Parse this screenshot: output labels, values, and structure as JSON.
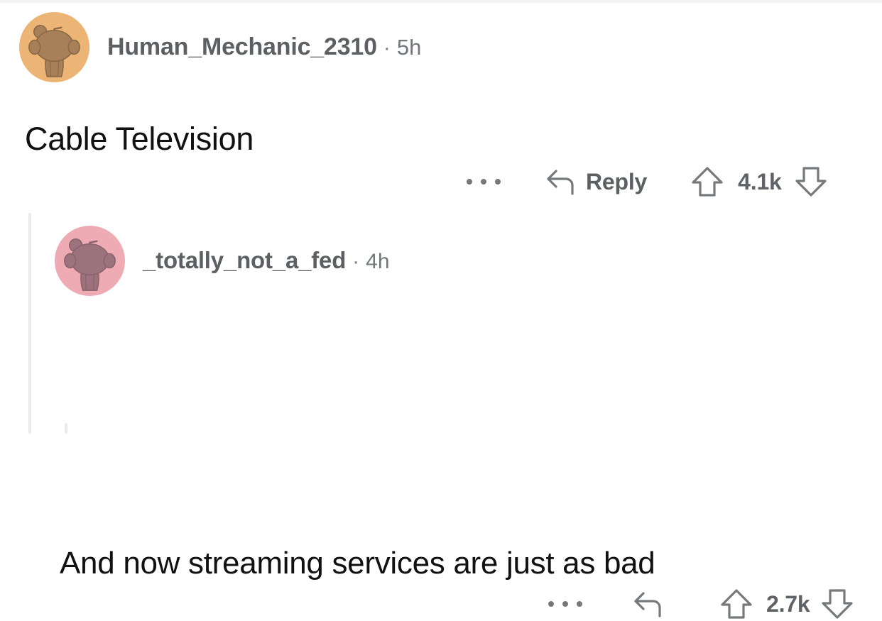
{
  "page": {
    "background_color": "#ffffff",
    "top_strip_color": "#f2f3f4",
    "thread_line_color": "#e8eaec"
  },
  "comments": [
    {
      "id": "root",
      "author": "Human_Mechanic_2310",
      "separator": "·",
      "timestamp": "5h",
      "body": "Cable Television",
      "avatar": {
        "icon": "reddit-snoo-avatar",
        "background_color": "#ecb575",
        "figure_color": "#a17b55",
        "outline_color": "#8a6845"
      },
      "actions": {
        "overflow_icon": "ellipsis-icon",
        "reply_icon": "reply-arrow-icon",
        "reply_label": "Reply",
        "upvote_icon": "upvote-arrow-icon",
        "score": "4.1k",
        "downvote_icon": "downvote-arrow-icon"
      }
    },
    {
      "id": "reply",
      "author": "_totally_not_a_fed",
      "separator": "·",
      "timestamp": "4h",
      "body": "And now streaming services are just as bad",
      "avatar": {
        "icon": "reddit-snoo-avatar",
        "background_color": "#eeabb4",
        "figure_color": "#9c737c",
        "outline_color": "#8a626b"
      },
      "actions": {
        "overflow_icon": "ellipsis-icon",
        "reply_icon": "reply-arrow-icon",
        "reply_label": "",
        "upvote_icon": "upvote-arrow-icon",
        "score": "2.7k",
        "downvote_icon": "downvote-arrow-icon"
      }
    }
  ]
}
